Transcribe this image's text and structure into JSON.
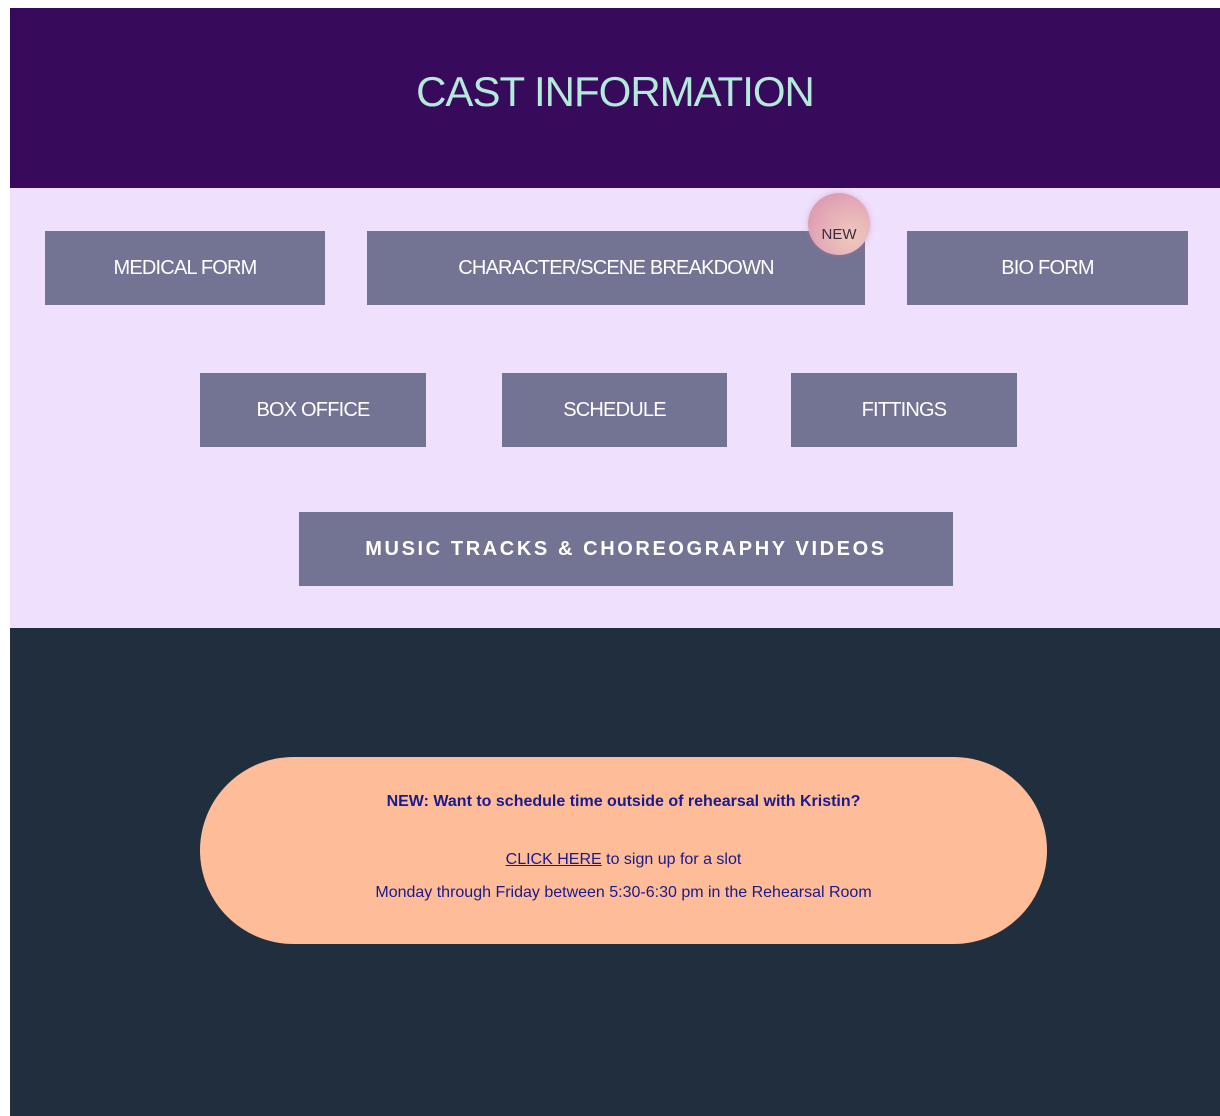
{
  "header": {
    "title": "CAST INFORMATION"
  },
  "buttons": {
    "medical_form": "MEDICAL FORM",
    "character_breakdown": "CHARACTER/SCENE BREAKDOWN",
    "new_badge": "NEW",
    "bio_form": "BIO FORM",
    "box_office": "BOX OFFICE",
    "schedule": "SCHEDULE",
    "fittings": "FITTINGS",
    "music_tracks": "MUSIC TRACKS & CHOREOGRAPHY VIDEOS"
  },
  "announcement": {
    "headline": "NEW:  Want to schedule time outside of rehearsal with Kristin?",
    "link_text": "CLICK HERE",
    "link_suffix": " to sign up for a slot",
    "details": "Monday through Friday between 5:30-6:30 pm in the Rehearsal Room"
  },
  "colors": {
    "header_bg": "#370a5b",
    "header_text": "#b4ead9",
    "buttons_bg": "#efe0fe",
    "button_fill": "#737393",
    "dark_bg": "#212e3d",
    "pill_bg": "#febc98",
    "pill_text": "#1a1a8a"
  }
}
